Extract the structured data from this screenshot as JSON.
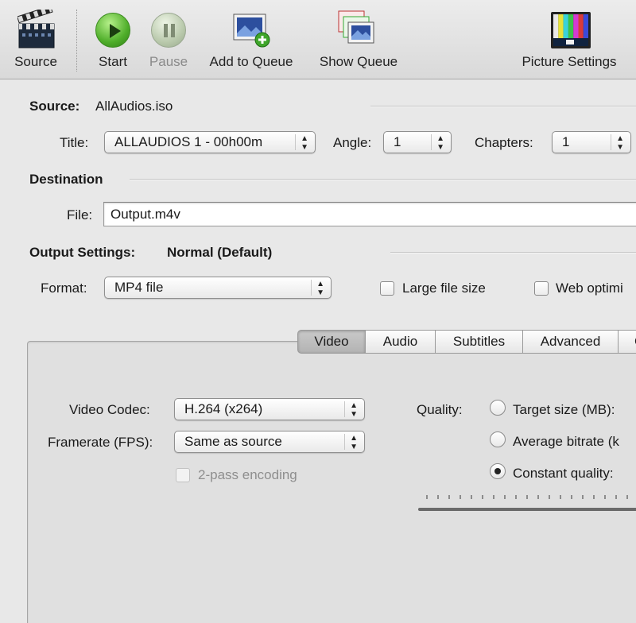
{
  "toolbar": {
    "source": "Source",
    "start": "Start",
    "pause": "Pause",
    "add_to_queue": "Add to Queue",
    "show_queue": "Show Queue",
    "picture_settings": "Picture Settings"
  },
  "source": {
    "label": "Source:",
    "value": "AllAudios.iso",
    "title_label": "Title:",
    "title_value": "ALLAUDIOS 1 - 00h00m",
    "angle_label": "Angle:",
    "angle_value": "1",
    "chapters_label": "Chapters:",
    "chapters_value": "1"
  },
  "destination": {
    "heading": "Destination",
    "file_label": "File:",
    "file_value": "Output.m4v"
  },
  "output": {
    "label": "Output Settings:",
    "preset": "Normal (Default)",
    "format_label": "Format:",
    "format_value": "MP4 file",
    "large_file": "Large file size",
    "web_optimized": "Web optimi"
  },
  "tabs": [
    "Video",
    "Audio",
    "Subtitles",
    "Advanced",
    "C"
  ],
  "video": {
    "codec_label": "Video Codec:",
    "codec_value": "H.264 (x264)",
    "framerate_label": "Framerate (FPS):",
    "framerate_value": "Same as source",
    "two_pass": "2-pass encoding",
    "quality_label": "Quality:",
    "target_size": "Target size (MB):",
    "avg_bitrate": "Average bitrate (k",
    "constant_quality": "Constant quality:"
  },
  "colors": {
    "accent_green": "#4fae2a",
    "window_bg": "#e8e8e8"
  }
}
